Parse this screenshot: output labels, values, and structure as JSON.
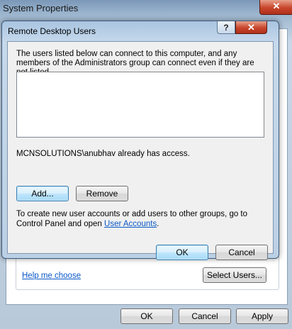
{
  "background_window": {
    "title": "System Properties",
    "close_glyph": "✕",
    "help_link": "Help me choose",
    "select_users_label": "Select Users...",
    "ok_label": "OK",
    "cancel_label": "Cancel",
    "apply_label": "Apply"
  },
  "dialog": {
    "title": "Remote Desktop Users",
    "help_glyph": "?",
    "close_glyph": "✕",
    "description": "The users listed below can connect to this computer, and any members of the Administrators group can connect even if they are not listed.",
    "users": [],
    "access_text": "MCNSOLUTIONS\\anubhav already has access.",
    "add_label": "Add...",
    "remove_label": "Remove",
    "info_prefix": "To create new user accounts or add users to other groups, go to Control Panel and open",
    "info_link": "User Accounts",
    "info_suffix": ".",
    "ok_label": "OK",
    "cancel_label": "Cancel"
  }
}
